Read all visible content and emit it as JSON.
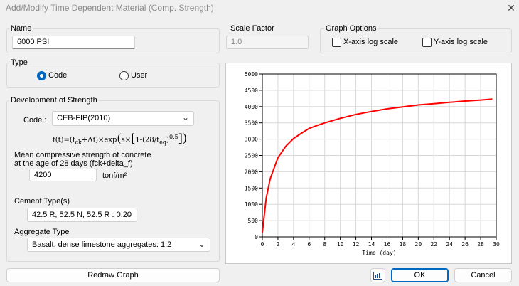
{
  "window": {
    "title": "Add/Modify Time Dependent Material (Comp. Strength)",
    "close_glyph": "✕"
  },
  "name_group": {
    "label": "Name",
    "value": "6000 PSI"
  },
  "scale_group": {
    "label": "Scale Factor",
    "value": "1.0"
  },
  "graph_options": {
    "label": "Graph Options",
    "x_log_label": "X-axis log scale",
    "y_log_label": "Y-axis log scale",
    "x_log_checked": false,
    "y_log_checked": false
  },
  "type_group": {
    "label": "Type",
    "code_label": "Code",
    "user_label": "User",
    "selected": "Code"
  },
  "strength_group": {
    "label": "Development of Strength",
    "code_label": "Code :",
    "code_value": "CEB-FIP(2010)",
    "formula": {
      "prefix": "f(t)=(f",
      "ck": "ck",
      "plus": "+Δf)×exp",
      "s": "s×",
      "one": "1-(28/t",
      "eq": "eq",
      "exp": "0.5"
    },
    "mean_label_1": "Mean compressive strength of concrete",
    "mean_label_2": "at the age of 28 days (fck+delta_f)",
    "mean_value": "4200",
    "mean_unit": "tonf/m²",
    "cement_label": "Cement Type(s)",
    "cement_value": "42.5 R, 52.5 N, 52.5 R : 0.20",
    "aggregate_label": "Aggregate Type",
    "aggregate_value": "Basalt, dense limestone aggregates: 1.2"
  },
  "buttons": {
    "redraw": "Redraw Graph",
    "ok": "OK",
    "cancel": "Cancel"
  },
  "icons": {
    "graph_copy": "chart-icon",
    "dropdown": "chevron-down-icon"
  },
  "colors": {
    "curve": "#ff0000",
    "accent": "#0067c0"
  },
  "chart_data": {
    "type": "line",
    "xlabel": "Time (day)",
    "ylabel": "",
    "xlim": [
      0,
      30
    ],
    "ylim": [
      0,
      5000
    ],
    "x_ticks": [
      0,
      2,
      4,
      6,
      8,
      10,
      12,
      14,
      16,
      18,
      20,
      22,
      24,
      26,
      28,
      30
    ],
    "y_ticks": [
      0,
      500,
      1000,
      1500,
      2000,
      2500,
      3000,
      3500,
      4000,
      4500,
      5000
    ],
    "grid": true,
    "series": [
      {
        "color": "#ff0000",
        "x": [
          0,
          0.5,
          1,
          2,
          3,
          4,
          5,
          6,
          7,
          8,
          10,
          12,
          14,
          16,
          18,
          20,
          22,
          24,
          26,
          28,
          29.5
        ],
        "y": [
          130,
          1200,
          1780,
          2430,
          2780,
          3020,
          3180,
          3330,
          3420,
          3500,
          3640,
          3760,
          3850,
          3930,
          3990,
          4050,
          4090,
          4130,
          4170,
          4200,
          4230
        ]
      }
    ]
  }
}
